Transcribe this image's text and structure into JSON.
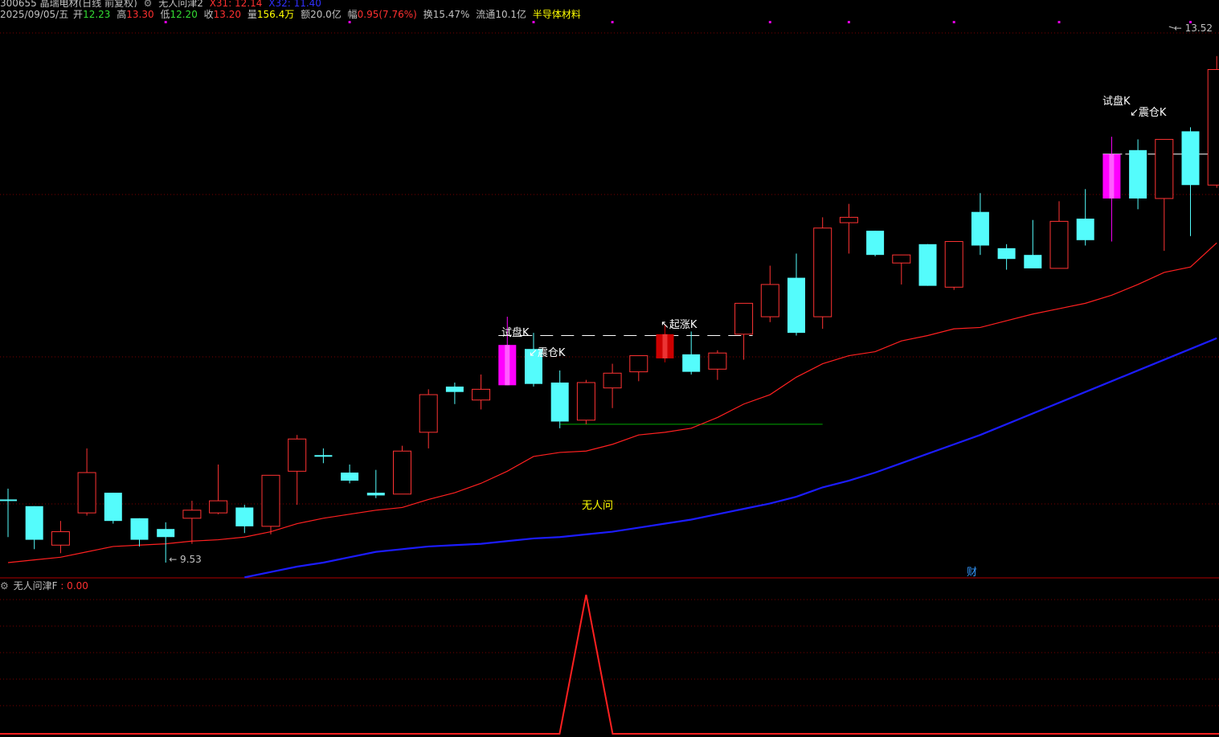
{
  "header": {
    "line1": {
      "stock": "300655 晶瑞电材(日线 前复权)",
      "indicator": "无人问津2",
      "x31": "X31: 12.14",
      "x32": "X32: 11.40"
    },
    "line2": {
      "date": "2025/09/05/五",
      "open_label": "开",
      "open": "12.23",
      "high_label": "高",
      "high": "13.30",
      "low_label": "低",
      "low": "12.20",
      "close_label": "收",
      "close": "13.20",
      "volume_label": "量",
      "volume": "156.4万",
      "amount_label": "额",
      "amount": "20.0亿",
      "change_label": "幅",
      "change": "0.95(7.76%)",
      "turnover_label": "换",
      "turnover": "15.47%",
      "float_label": "流通",
      "float": "10.1亿",
      "sector": "半导体材料"
    }
  },
  "sub_panel": {
    "title": "无人问津F",
    "value": ": 0.00"
  },
  "colors": {
    "up": "#ff3333",
    "down": "#54fcfc",
    "signal": "#ff00ff",
    "start": "#cc0000",
    "ma_short": "#ff2020",
    "ma_long": "#1c1cff",
    "grid": "#7a0000",
    "label": "#ffffff",
    "label_yellow": "#ffff00",
    "support": "#00aa00"
  },
  "chart_data": {
    "type": "candlestick",
    "price_range": [
      9.2,
      13.7
    ],
    "max_label": "13.52",
    "min_label": "9.53",
    "candles": [
      {
        "o": 10.0,
        "h": 10.08,
        "l": 9.72,
        "c": 10.0,
        "style": "doji"
      },
      {
        "o": 9.95,
        "h": 9.95,
        "l": 9.63,
        "c": 9.7,
        "style": "down"
      },
      {
        "o": 9.66,
        "h": 9.84,
        "l": 9.6,
        "c": 9.76,
        "style": "up"
      },
      {
        "o": 9.9,
        "h": 10.38,
        "l": 9.88,
        "c": 10.2,
        "style": "up"
      },
      {
        "o": 10.05,
        "h": 10.05,
        "l": 9.82,
        "c": 9.84,
        "style": "down"
      },
      {
        "o": 9.86,
        "h": 9.86,
        "l": 9.65,
        "c": 9.7,
        "style": "down"
      },
      {
        "o": 9.78,
        "h": 9.83,
        "l": 9.53,
        "c": 9.72,
        "style": "down"
      },
      {
        "o": 9.86,
        "h": 9.99,
        "l": 9.67,
        "c": 9.92,
        "style": "up"
      },
      {
        "o": 9.9,
        "h": 10.26,
        "l": 9.89,
        "c": 9.99,
        "style": "up"
      },
      {
        "o": 9.94,
        "h": 9.96,
        "l": 9.75,
        "c": 9.8,
        "style": "down"
      },
      {
        "o": 9.8,
        "h": 10.18,
        "l": 9.74,
        "c": 10.18,
        "style": "up"
      },
      {
        "o": 10.21,
        "h": 10.48,
        "l": 9.96,
        "c": 10.45,
        "style": "up"
      },
      {
        "o": 10.33,
        "h": 10.38,
        "l": 10.27,
        "c": 10.33,
        "style": "doji"
      },
      {
        "o": 10.2,
        "h": 10.26,
        "l": 10.12,
        "c": 10.14,
        "style": "down"
      },
      {
        "o": 10.05,
        "h": 10.22,
        "l": 10.01,
        "c": 10.03,
        "style": "down"
      },
      {
        "o": 10.04,
        "h": 10.4,
        "l": 10.04,
        "c": 10.36,
        "style": "up"
      },
      {
        "o": 10.5,
        "h": 10.82,
        "l": 10.38,
        "c": 10.78,
        "style": "up"
      },
      {
        "o": 10.84,
        "h": 10.87,
        "l": 10.71,
        "c": 10.8,
        "style": "down"
      },
      {
        "o": 10.74,
        "h": 10.93,
        "l": 10.67,
        "c": 10.82,
        "style": "up"
      },
      {
        "o": 11.15,
        "h": 11.36,
        "l": 10.85,
        "c": 10.85,
        "style": "signal"
      },
      {
        "o": 11.12,
        "h": 11.24,
        "l": 10.84,
        "c": 10.86,
        "style": "down"
      },
      {
        "o": 10.87,
        "h": 10.96,
        "l": 10.53,
        "c": 10.58,
        "style": "down"
      },
      {
        "o": 10.59,
        "h": 10.89,
        "l": 10.56,
        "c": 10.87,
        "style": "up"
      },
      {
        "o": 10.83,
        "h": 11.01,
        "l": 10.68,
        "c": 10.94,
        "style": "up"
      },
      {
        "o": 10.95,
        "h": 11.07,
        "l": 10.88,
        "c": 11.07,
        "style": "up"
      },
      {
        "o": 11.05,
        "h": 11.3,
        "l": 11.02,
        "c": 11.23,
        "style": "start"
      },
      {
        "o": 11.08,
        "h": 11.25,
        "l": 10.93,
        "c": 10.95,
        "style": "down"
      },
      {
        "o": 10.97,
        "h": 11.11,
        "l": 10.89,
        "c": 11.09,
        "style": "up"
      },
      {
        "o": 11.23,
        "h": 11.46,
        "l": 11.04,
        "c": 11.46,
        "style": "up"
      },
      {
        "o": 11.36,
        "h": 11.74,
        "l": 11.32,
        "c": 11.6,
        "style": "up"
      },
      {
        "o": 11.65,
        "h": 11.83,
        "l": 11.22,
        "c": 11.24,
        "style": "down"
      },
      {
        "o": 11.36,
        "h": 12.1,
        "l": 11.27,
        "c": 12.02,
        "style": "up"
      },
      {
        "o": 12.1,
        "h": 12.2,
        "l": 11.83,
        "c": 12.06,
        "style": "up"
      },
      {
        "o": 12.0,
        "h": 12.0,
        "l": 11.81,
        "c": 11.82,
        "style": "down"
      },
      {
        "o": 11.76,
        "h": 11.82,
        "l": 11.6,
        "c": 11.82,
        "style": "up"
      },
      {
        "o": 11.9,
        "h": 11.9,
        "l": 11.59,
        "c": 11.59,
        "style": "down"
      },
      {
        "o": 11.58,
        "h": 11.92,
        "l": 11.56,
        "c": 11.92,
        "style": "up"
      },
      {
        "o": 12.14,
        "h": 12.28,
        "l": 11.82,
        "c": 11.89,
        "style": "down"
      },
      {
        "o": 11.87,
        "h": 11.9,
        "l": 11.71,
        "c": 11.79,
        "style": "down"
      },
      {
        "o": 11.82,
        "h": 12.08,
        "l": 11.75,
        "c": 11.72,
        "style": "down"
      },
      {
        "o": 11.72,
        "h": 12.22,
        "l": 11.72,
        "c": 12.07,
        "style": "up"
      },
      {
        "o": 12.09,
        "h": 12.31,
        "l": 11.89,
        "c": 11.93,
        "style": "down"
      },
      {
        "o": 12.57,
        "h": 12.7,
        "l": 11.92,
        "c": 12.24,
        "style": "signal"
      },
      {
        "o": 12.6,
        "h": 12.68,
        "l": 12.16,
        "c": 12.24,
        "style": "down"
      },
      {
        "o": 12.24,
        "h": 12.68,
        "l": 11.85,
        "c": 12.68,
        "style": "up"
      },
      {
        "o": 12.74,
        "h": 12.77,
        "l": 11.96,
        "c": 12.34,
        "style": "down"
      },
      {
        "o": 12.34,
        "h": 13.3,
        "l": 12.32,
        "c": 13.2,
        "style": "up"
      }
    ],
    "ma_short": [
      9.53,
      9.55,
      9.57,
      9.61,
      9.65,
      9.66,
      9.67,
      9.69,
      9.7,
      9.72,
      9.76,
      9.82,
      9.86,
      9.89,
      9.92,
      9.94,
      10.0,
      10.05,
      10.12,
      10.21,
      10.32,
      10.35,
      10.36,
      10.41,
      10.48,
      10.5,
      10.53,
      10.61,
      10.71,
      10.78,
      10.91,
      11.01,
      11.07,
      11.1,
      11.18,
      11.22,
      11.27,
      11.28,
      11.33,
      11.38,
      11.42,
      11.46,
      11.52,
      11.6,
      11.69,
      11.73,
      11.91
    ],
    "ma_long": [
      9.42,
      9.46,
      9.5,
      9.53,
      9.57,
      9.61,
      9.63,
      9.65,
      9.66,
      9.67,
      9.69,
      9.71,
      9.72,
      9.74,
      9.76,
      9.79,
      9.82,
      9.85,
      9.89,
      9.93,
      9.97,
      10.02,
      10.09,
      10.14,
      10.2,
      10.27,
      10.34,
      10.41,
      10.48,
      10.56,
      10.64,
      10.72,
      10.8,
      10.88,
      10.96,
      11.04,
      11.12,
      11.2
    ],
    "resistance_level": 11.22,
    "support_level": 10.56,
    "annotations": [
      {
        "text": "试盘K",
        "index": 19
      },
      {
        "text": "↙震仓K",
        "index": 20
      },
      {
        "text": "↖起涨K",
        "index": 25
      },
      {
        "text": "无人问",
        "index": 22
      },
      {
        "text": "试盘K",
        "index": 42
      },
      {
        "text": "↙震仓K",
        "index": 43
      },
      {
        "text": "财",
        "index": 37
      }
    ],
    "sub_indicator": {
      "name": "无人问津F",
      "value": 0.0,
      "spike_index": 22,
      "spike_value": 1.0
    },
    "top_markers_index": [
      6,
      13,
      20,
      23,
      29,
      32,
      36,
      40,
      45
    ]
  }
}
